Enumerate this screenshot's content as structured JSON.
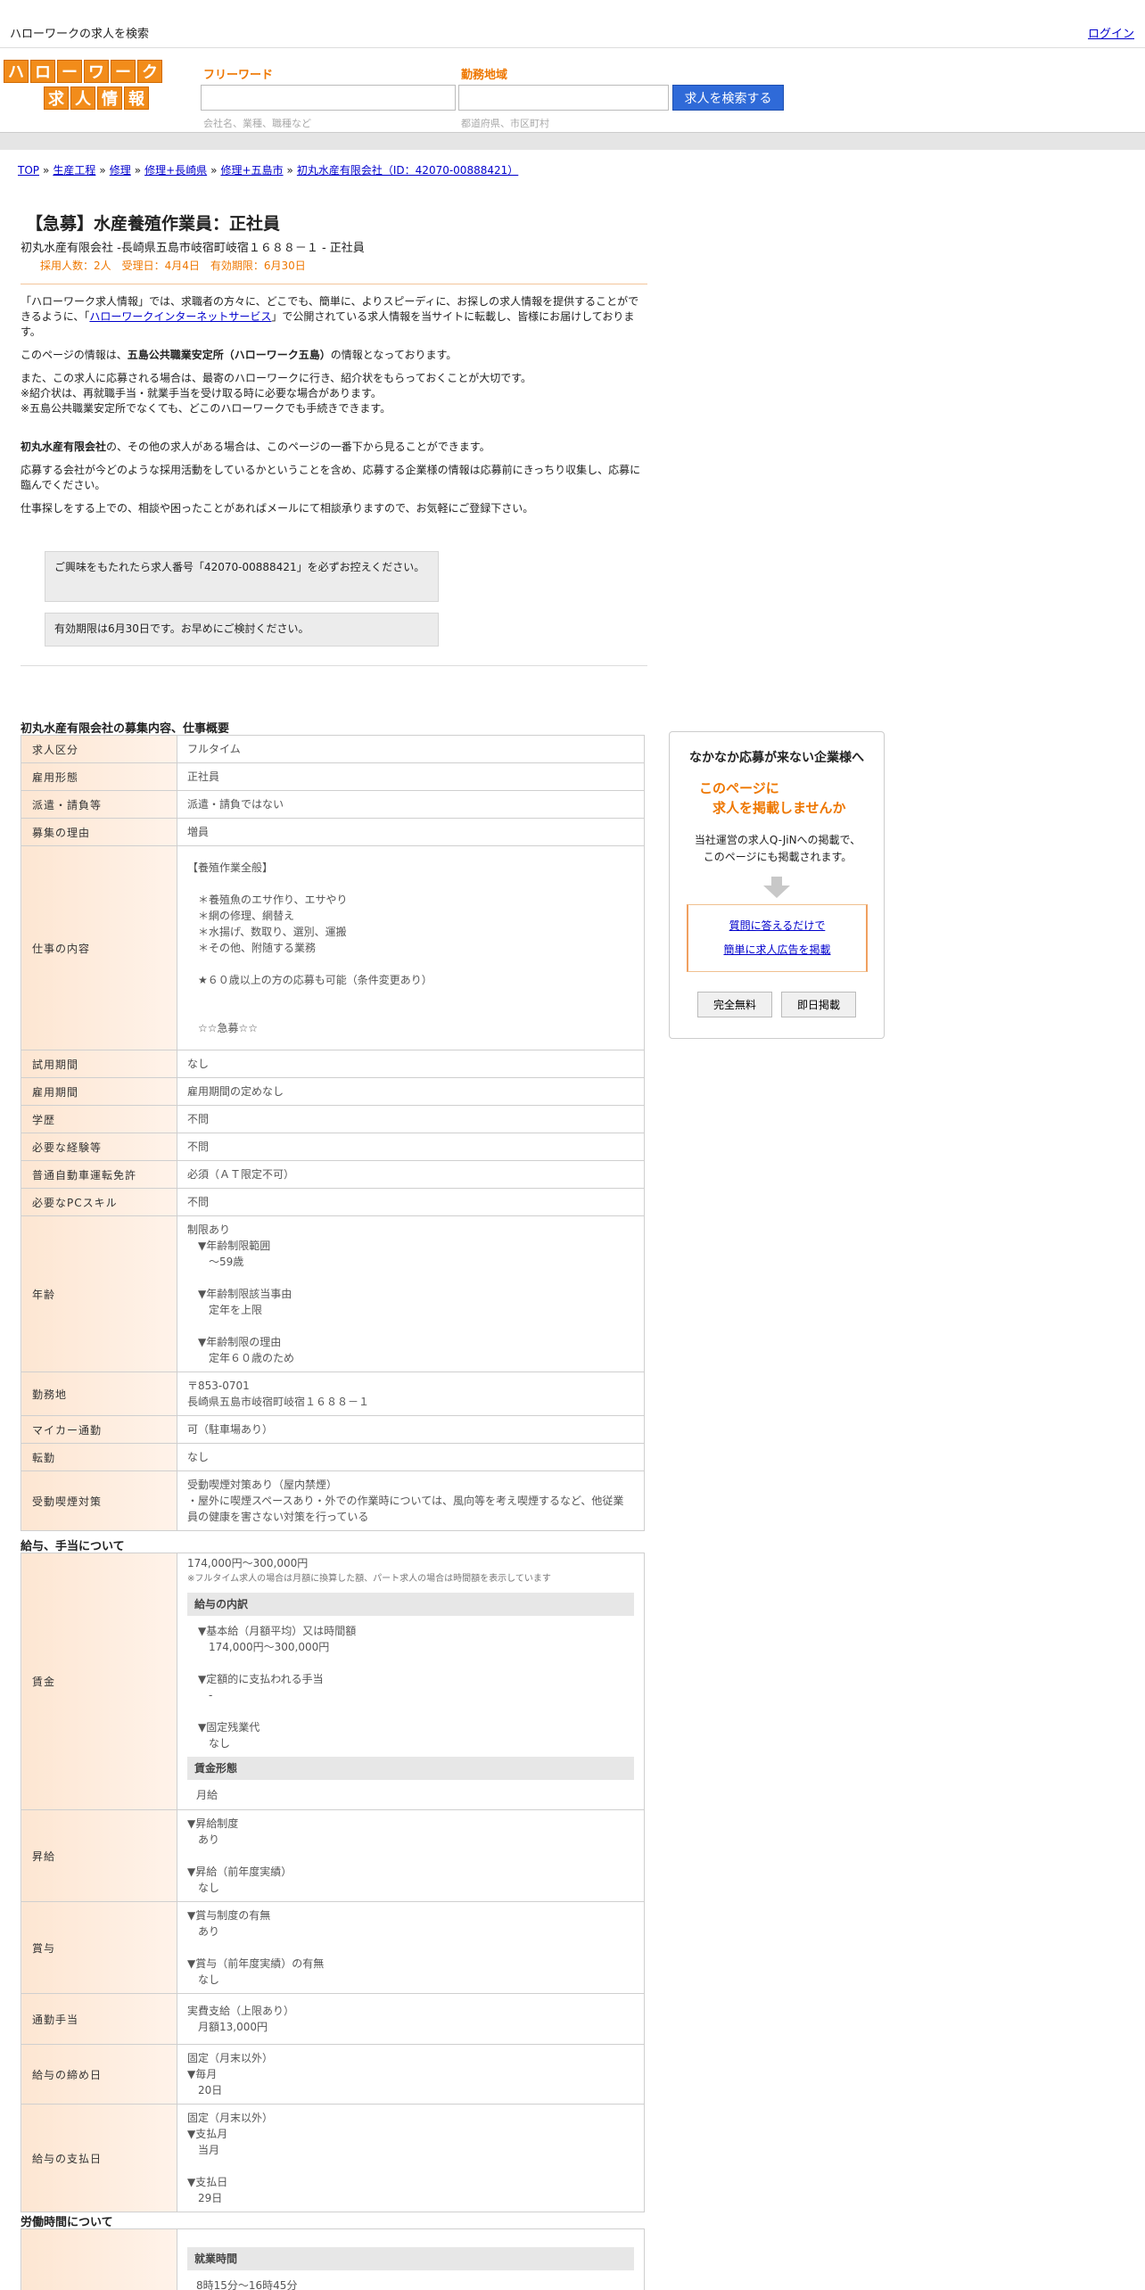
{
  "topbar": {
    "title": "ハローワークの求人を検索",
    "login": "ログイン"
  },
  "header": {
    "logo_row1": [
      "ハ",
      "ロ",
      "ー",
      "ワ",
      "ー",
      "ク"
    ],
    "logo_row2": [
      "求",
      "人",
      "情",
      "報"
    ],
    "freeword_label": "フリーワード",
    "freeword_value": "",
    "freeword_hint": "会社名、業種、職種など",
    "area_label": "勤務地域",
    "area_value": "",
    "area_hint": "都道府県、市区町村",
    "search_button": "求人を検索する"
  },
  "breadcrumb": [
    "TOP",
    "生産工程",
    "修理",
    "修理+長崎県",
    "修理+五島市",
    "初丸水産有限会社（ID：42070-00888421）"
  ],
  "job": {
    "title": "【急募】水産養殖作業員：正社員",
    "company_line": "初丸水産有限会社 -長崎県五島市岐宿町岐宿１６８８－１ - 正社員",
    "meta": "採用人数：2人　受理日：4月4日　有効期限：6月30日"
  },
  "intro": {
    "p1_a": "「ハローワーク求人情報」では、求職者の方々に、どこでも、簡単に、よりスピーディに、お探しの求人情報を提供することができるように、「",
    "p1_link": "ハローワークインターネットサービス",
    "p1_b": "」で公開されている求人情報を当サイトに転載し、皆様にお届けしております。",
    "p2_a": "このページの情報は、",
    "p2_bold": "五島公共職業安定所（ハローワーク五島）",
    "p2_b": "の情報となっております。",
    "p3": "また、この求人に応募される場合は、最寄のハローワークに行き、紹介状をもらっておくことが大切です。\n※紹介状は、再就職手当・就業手当を受け取る時に必要な場合があります。\n※五島公共職業安定所でなくても、どこのハローワークでも手続きできます。",
    "p4_bold": "初丸水産有限会社",
    "p4": "の、その他の求人がある場合は、このページの一番下から見ることができます。",
    "p5": "応募する会社が今どのような採用活動をしているかということを含め、応募する企業様の情報は応募前にきっちり収集し、応募に臨んでください。",
    "p6": "仕事探しをする上での、相談や困ったことがあればメールにて相談承りますので、お気軽にご登録下さい。"
  },
  "notices": {
    "n1": "ご興味をもたれたら求人番号「42070-00888421」を必ずお控えください。",
    "n2": "有効期限は6月30日です。お早めにご検討ください。"
  },
  "summary": {
    "heading": "初丸水産有限会社の募集内容、仕事概要",
    "rows": [
      {
        "label": "求人区分",
        "value": "フルタイム"
      },
      {
        "label": "雇用形態",
        "value": "正社員"
      },
      {
        "label": "派遣・請負等",
        "value": "派遣・請負ではない"
      },
      {
        "label": "募集の理由",
        "value": "増員"
      },
      {
        "label": "仕事の内容",
        "value": "【養殖作業全般】\n\n　＊養殖魚のエサ作り、エサやり\n　＊網の修理、網替え\n　＊水揚げ、数取り、選別、運搬\n　＊その他、附随する業務\n\n　★６０歳以上の方の応募も可能（条件変更あり）\n\n\n　☆☆急募☆☆"
      },
      {
        "label": "試用期間",
        "value": "なし"
      },
      {
        "label": "雇用期間",
        "value": "雇用期間の定めなし"
      },
      {
        "label": "学歴",
        "value": "不問"
      },
      {
        "label": "必要な経験等",
        "value": "不問"
      },
      {
        "label": "普通自動車運転免許",
        "value": "必須（ＡＴ限定不可）"
      },
      {
        "label": "必要なPCスキル",
        "value": "不問"
      },
      {
        "label": "年齢",
        "value": "制限あり\n　▼年齢制限範囲\n　　〜59歳\n\n　▼年齢制限該当事由\n　　定年を上限\n\n　▼年齢制限の理由\n　　定年６０歳のため"
      },
      {
        "label": "勤務地",
        "value": "〒853-0701\n長崎県五島市岐宿町岐宿１６８８－１"
      },
      {
        "label": "マイカー通勤",
        "value": "可（駐車場あり）"
      },
      {
        "label": "転勤",
        "value": "なし"
      },
      {
        "label": "受動喫煙対策",
        "value": "受動喫煙対策あり（屋内禁煙）\n・屋外に喫煙スペースあり・外での作業時については、風向等を考え喫煙するなど、他従業員の健康を害さない対策を行っている"
      }
    ]
  },
  "salary": {
    "heading": "給与、手当について",
    "wage_label": "賃金",
    "wage_range": "174,000円〜300,000円",
    "wage_note": "※フルタイム求人の場合は月額に換算した額、パート求人の場合は時間額を表示しています",
    "wage_sub1": "給与の内訳",
    "wage_detail": "　▼基本給（月額平均）又は時間額\n　　174,000円〜300,000円\n\n　▼定額的に支払われる手当\n　　-\n\n　▼固定残業代\n　　なし",
    "wage_sub2": "賃金形態",
    "wage_form": "月給",
    "rows": [
      {
        "label": "昇給",
        "value": "▼昇給制度\n　あり\n\n▼昇給（前年度実績）\n　なし"
      },
      {
        "label": "賞与",
        "value": "▼賞与制度の有無\n　あり\n\n▼賞与（前年度実績）の有無\n　なし"
      },
      {
        "label": "通勤手当",
        "value": "実費支給（上限あり）\n　月額13,000円"
      },
      {
        "label": "給与の締め日",
        "value": "固定（月末以外）\n▼毎月\n　20日"
      },
      {
        "label": "給与の支払日",
        "value": "固定（月末以外）\n▼支払月\n　当月\n\n▼支払日\n　29日"
      }
    ]
  },
  "hours": {
    "heading": "労働時間について",
    "sub1": "就業時間",
    "value1": "8時15分〜16時45分"
  },
  "ad": {
    "title": "なかなか応募が来ない企業様へ",
    "catch1": "このページに",
    "catch2": "求人を掲載しませんか",
    "body": "当社運営の求人Q-JiNへの掲載で、\nこのページにも掲載されます。",
    "link1": "質問に答えるだけで",
    "link2": "簡単に求人広告を掲載",
    "btn1": "完全無料",
    "btn2": "即日掲載"
  }
}
